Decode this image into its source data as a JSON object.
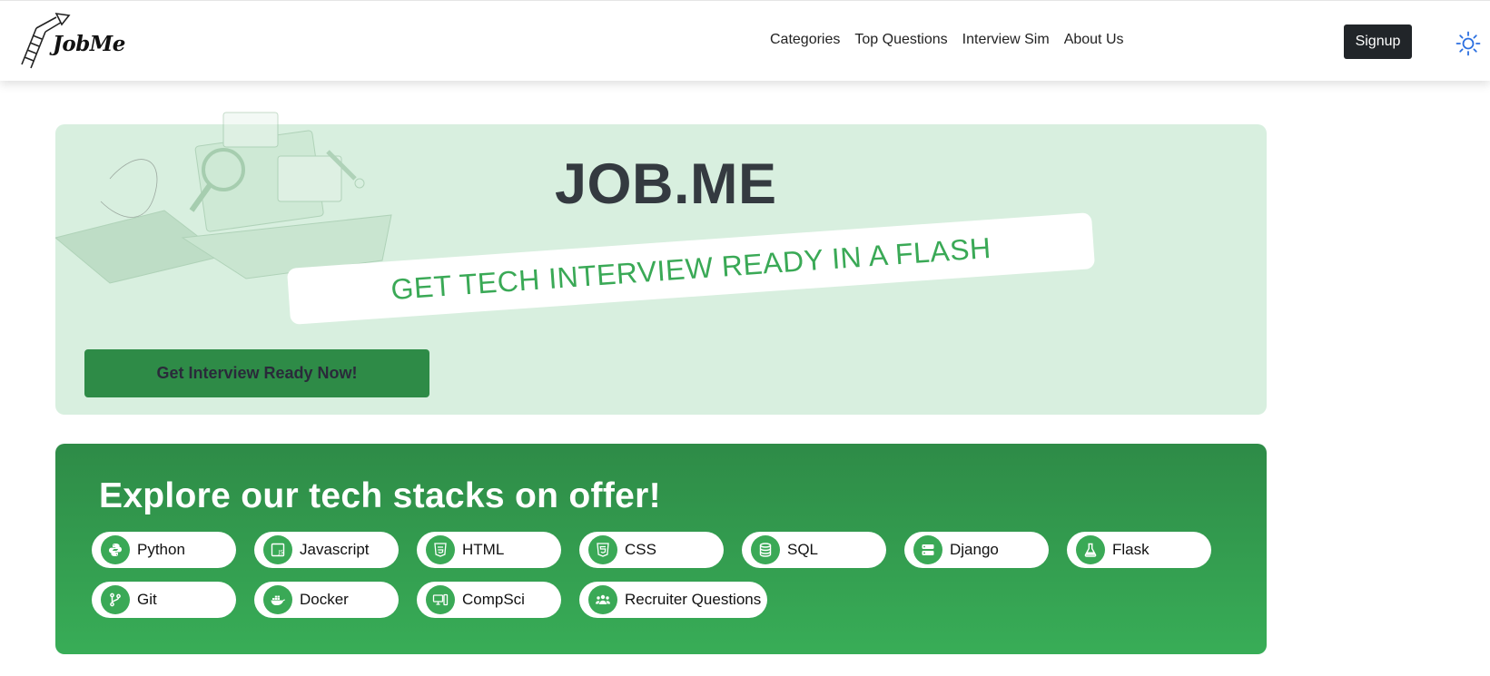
{
  "brand": {
    "name": "JobMe"
  },
  "nav": {
    "links": [
      "Categories",
      "Top Questions",
      "Interview Sim",
      "About Us"
    ],
    "signup_label": "Signup"
  },
  "hero": {
    "title": "JOB.ME",
    "tagline": "GET TECH INTERVIEW READY IN A FLASH",
    "cta_label": "Get Interview Ready Now!"
  },
  "stacks": {
    "title": "Explore our tech stacks on offer!",
    "items": [
      {
        "label": "Python",
        "icon": "python-icon"
      },
      {
        "label": "Javascript",
        "icon": "javascript-icon"
      },
      {
        "label": "HTML",
        "icon": "html-icon"
      },
      {
        "label": "CSS",
        "icon": "css-icon"
      },
      {
        "label": "SQL",
        "icon": "database-icon"
      },
      {
        "label": "Django",
        "icon": "server-icon"
      },
      {
        "label": "Flask",
        "icon": "flask-icon"
      },
      {
        "label": "Git",
        "icon": "git-branch-icon"
      },
      {
        "label": "Docker",
        "icon": "docker-icon"
      },
      {
        "label": "CompSci",
        "icon": "computer-icon"
      },
      {
        "label": "Recruiter Questions",
        "icon": "people-icon"
      }
    ]
  },
  "colors": {
    "accent_green": "#3aa956",
    "dark_green": "#2e8b47",
    "hero_bg": "#d8efdf",
    "dark": "#212529"
  }
}
